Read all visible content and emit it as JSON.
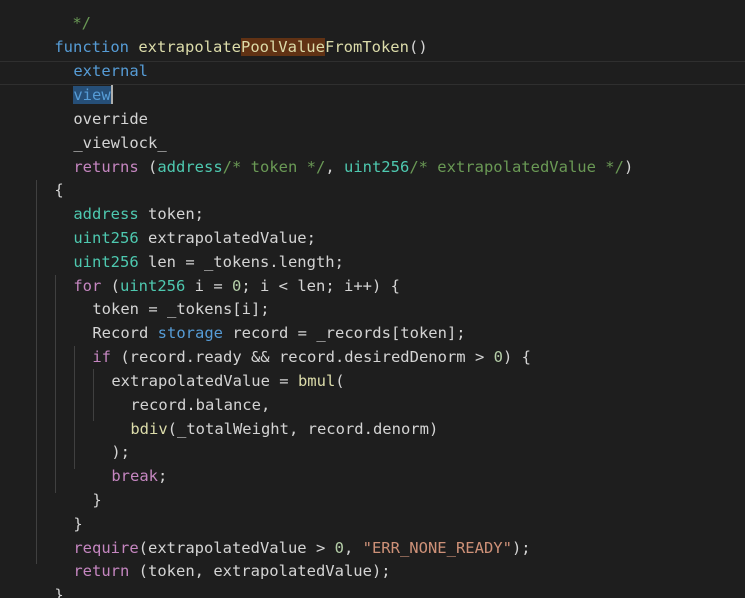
{
  "editor": {
    "top_partial": "*/",
    "lines": [
      [
        "function",
        " ",
        "extrapolate",
        "PoolValue",
        "FromToken",
        "()"
      ],
      [
        "external"
      ],
      [
        "view"
      ],
      [
        "override"
      ],
      [
        "_viewlock_"
      ],
      [
        "returns",
        " (",
        "address",
        "/* token */",
        ", ",
        "uint256",
        "/* extrapolatedValue */",
        ")"
      ],
      [
        "{"
      ],
      [
        "address",
        " token;"
      ],
      [
        "uint256",
        " extrapolatedValue;"
      ],
      [
        "uint256",
        " len = _tokens.length;"
      ],
      [
        "for",
        " (",
        "uint256",
        " i = ",
        "0",
        "; i < len; i++) {"
      ],
      [
        "token = _tokens[i];"
      ],
      [
        "Record",
        " ",
        "storage",
        " record = _records[token];"
      ],
      [
        "if",
        " (record.ready && record.desiredDenorm > ",
        "0",
        ") {"
      ],
      [
        "extrapolatedValue = ",
        "bmul",
        "("
      ],
      [
        "record.balance,"
      ],
      [
        "bdiv",
        "(_totalWeight, record.denorm)"
      ],
      [
        ");"
      ],
      [
        "break",
        ";"
      ],
      [
        "}"
      ],
      [
        "}"
      ],
      [
        "require",
        "(extrapolatedValue > ",
        "0",
        ", ",
        "\"ERR_NONE_READY\"",
        ");"
      ],
      [
        "return",
        " (token, extrapolatedValue);"
      ],
      [
        "}"
      ]
    ]
  }
}
